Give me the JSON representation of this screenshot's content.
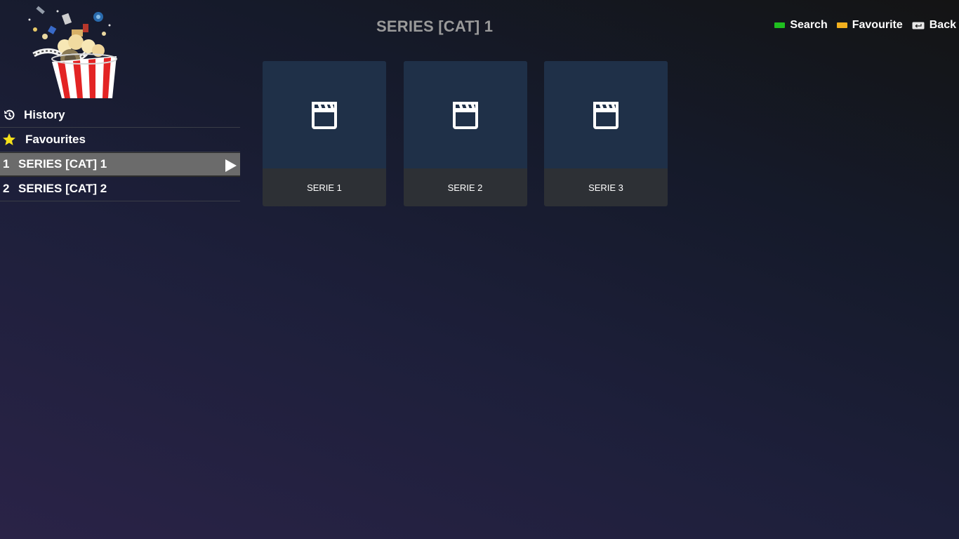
{
  "header": {
    "title": "SERIES [CAT] 1",
    "actions": [
      {
        "label": "Search",
        "color": "#1fbf1f"
      },
      {
        "label": "Favourite",
        "color": "#f2b01e"
      },
      {
        "label": "Back",
        "icon": "return-key-icon"
      }
    ]
  },
  "sidebar": {
    "history": {
      "label": "History",
      "icon": "history-icon"
    },
    "favourites": {
      "label": "Favourites",
      "icon": "star-icon",
      "icon_color": "#f5e01a"
    },
    "categories": [
      {
        "num": "1",
        "label": "SERIES [CAT] 1",
        "active": true
      },
      {
        "num": "2",
        "label": "SERIES [CAT] 2",
        "active": false
      }
    ]
  },
  "cards": [
    {
      "title": "SERIE 1",
      "icon": "clapperboard-icon"
    },
    {
      "title": "SERIE 2",
      "icon": "clapperboard-icon"
    },
    {
      "title": "SERIE 3",
      "icon": "clapperboard-icon"
    }
  ],
  "colors": {
    "card_thumb": "#1f3048",
    "card_footer": "#2d3035",
    "active_row": "#6b6b6b",
    "title_text": "#9a9a9a"
  }
}
